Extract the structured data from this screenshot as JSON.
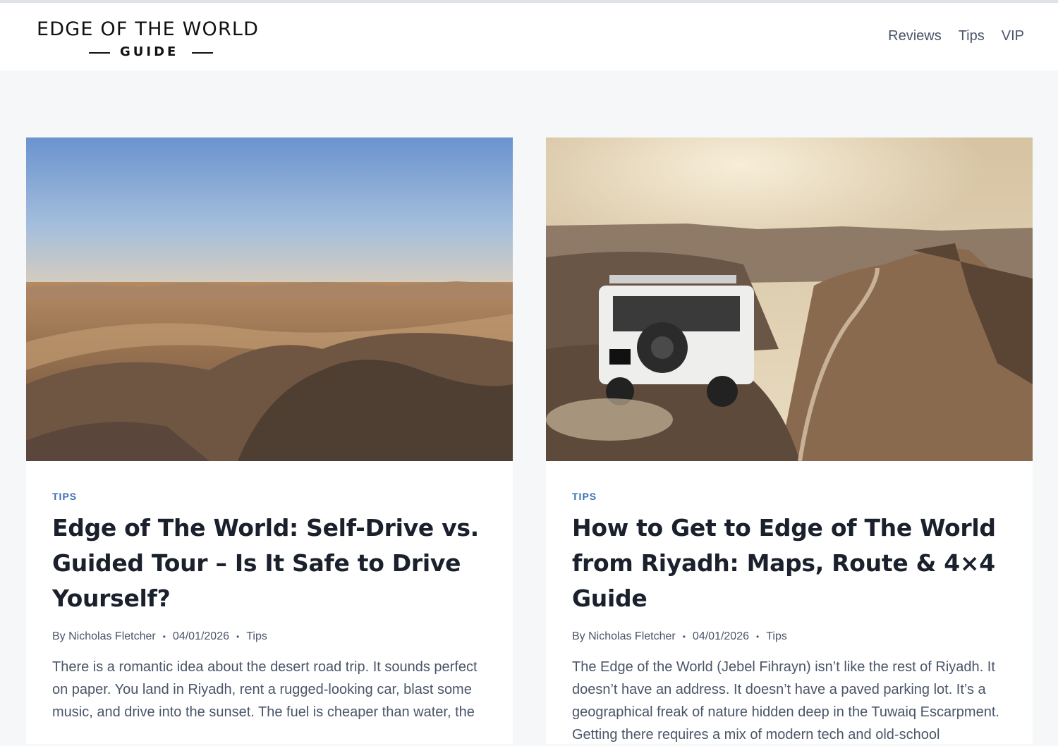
{
  "site": {
    "logo_main": "EDGE OF THE WORLD",
    "logo_sub": "GUIDE"
  },
  "nav": [
    {
      "label": "Reviews"
    },
    {
      "label": "Tips"
    },
    {
      "label": "VIP"
    }
  ],
  "posts": [
    {
      "category": "TIPS",
      "title": "Edge of The World: Self-Drive vs. Guided Tour – Is It Safe to Drive Yourself?",
      "author": "By Nicholas Fletcher",
      "date": "04/01/2026",
      "meta_category": "Tips",
      "excerpt": "There is a romantic idea about the desert road trip. It sounds perfect on paper. You land in Riyadh, rent a rugged-looking car, blast some music, and drive into the sunset. The fuel is cheaper than water, the"
    },
    {
      "category": "TIPS",
      "title": "How to Get to Edge of The World from Riyadh: Maps, Route & 4×4 Guide",
      "author": "By Nicholas Fletcher",
      "date": "04/01/2026",
      "meta_category": "Tips",
      "excerpt": "The Edge of the World (Jebel Fihrayn) isn’t like the rest of Riyadh. It doesn’t have an address. It doesn’t have a paved parking lot. It’s a geographical freak of nature hidden deep in the Tuwaiq Escarpment. Getting there requires a mix of modern tech and old-school"
    }
  ],
  "colors": {
    "accent": "#3a6fb0",
    "background": "#f6f7f9"
  }
}
